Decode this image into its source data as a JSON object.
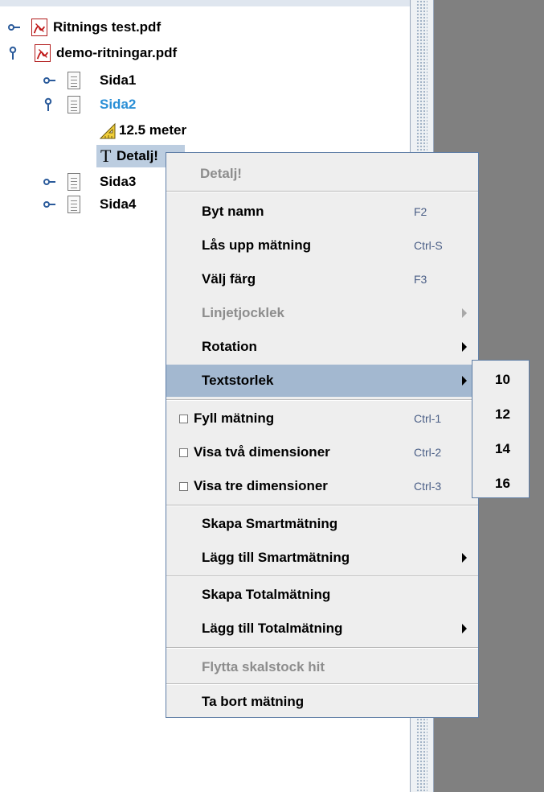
{
  "tree": {
    "files": [
      {
        "name": "Ritnings test.pdf",
        "expanded": false
      },
      {
        "name": "demo-ritningar.pdf",
        "expanded": true
      }
    ],
    "pages": [
      {
        "name": "Sida1",
        "expanded": false
      },
      {
        "name": "Sida2",
        "expanded": true,
        "color": "#2a8fd6"
      },
      {
        "name": "Sida3",
        "expanded": false
      },
      {
        "name": "Sida4",
        "expanded": false
      }
    ],
    "measurements": [
      {
        "name": "12.5 meter",
        "icon": "ruler-triangle-icon"
      },
      {
        "name": "Detalj!",
        "icon": "text-t-icon",
        "selected": true
      }
    ]
  },
  "context_menu": {
    "title": "Detalj!",
    "items": [
      {
        "label": "Byt namn",
        "shortcut": "F2"
      },
      {
        "label": "Lås upp mätning",
        "shortcut": "Ctrl-S"
      },
      {
        "label": "Välj färg",
        "shortcut": "F3"
      },
      {
        "label": "Linjetjocklek",
        "disabled": true,
        "submenu": true
      },
      {
        "label": "Rotation",
        "submenu": true
      },
      {
        "label": "Textstorlek",
        "submenu": true,
        "selected": true
      },
      {
        "label": "Fyll mätning",
        "shortcut": "Ctrl-1",
        "checkbox": true,
        "checked": false
      },
      {
        "label": "Visa två dimensioner",
        "shortcut": "Ctrl-2",
        "checkbox": true,
        "checked": false
      },
      {
        "label": "Visa tre dimensioner",
        "shortcut": "Ctrl-3",
        "checkbox": true,
        "checked": false
      },
      {
        "label": "Skapa Smartmätning"
      },
      {
        "label": "Lägg till Smartmätning",
        "submenu": true
      },
      {
        "label": "Skapa Totalmätning"
      },
      {
        "label": "Lägg till Totalmätning",
        "submenu": true
      },
      {
        "label": "Flytta skalstock hit",
        "disabled": true
      },
      {
        "label": "Ta bort mätning"
      }
    ]
  },
  "textsize_submenu": {
    "options": [
      "10",
      "12",
      "14",
      "16"
    ]
  },
  "colors": {
    "selection": "#a3b8d0",
    "menu_border": "#5f7ea6",
    "shortcut": "#4a5e86",
    "active_page": "#2a8fd6",
    "pdf_red": "#b11b1b",
    "gray_pane": "#808080"
  }
}
